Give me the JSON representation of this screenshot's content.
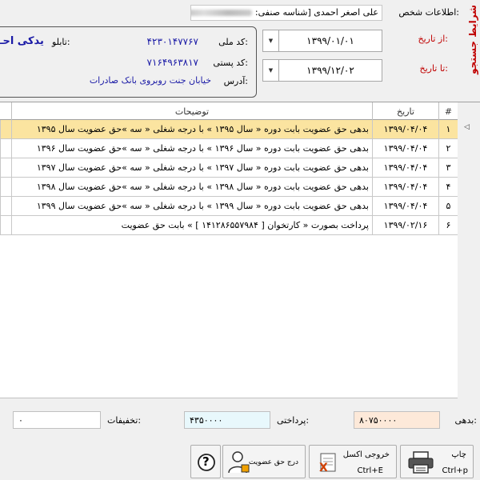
{
  "search_panel": {
    "title": "شرایط جستجو",
    "person_label": "اطلاعات شخص:",
    "person_value": "علی اصغر احمدی [شناسه صنفی:",
    "person_suffix": "]",
    "from_date_label": "از تاریخ:",
    "from_date": "۱۳۹۹/۰۱/۰۱",
    "to_date_label": "تا تاریخ:",
    "to_date": "۱۳۹۹/۱۲/۰۲"
  },
  "info": {
    "national_code_label": "کد ملی:",
    "national_code": "۴۲۳۰۱۴۷۷۶۷",
    "sign_label": "تابلو:",
    "sign_value": "یدکی احـ",
    "postal_code_label": "کد پستی:",
    "postal_code": "۷۱۶۴۹۶۳۸۱۷",
    "address_label": "آدرس:",
    "address": "خیابان جنت روبروی بانک صادرات"
  },
  "grid": {
    "columns": {
      "num": "#",
      "date": "تاریخ",
      "desc": "توضیحات"
    },
    "rows": [
      {
        "num": "۱",
        "date": "۱۳۹۹/۰۴/۰۴",
        "desc": "بدهی حق عضویت بابت دوره « سال ۱۳۹۵ » با درجه شغلی « سه »حق عضویت سال ۱۳۹۵",
        "selected": true
      },
      {
        "num": "۲",
        "date": "۱۳۹۹/۰۴/۰۴",
        "desc": "بدهی حق عضویت بابت دوره « سال ۱۳۹۶ » با درجه شغلی « سه »حق عضویت سال ۱۳۹۶",
        "selected": false
      },
      {
        "num": "۳",
        "date": "۱۳۹۹/۰۴/۰۴",
        "desc": "بدهی حق عضویت بابت دوره « سال ۱۳۹۷ » با درجه شغلی « سه »حق عضویت سال ۱۳۹۷",
        "selected": false
      },
      {
        "num": "۴",
        "date": "۱۳۹۹/۰۴/۰۴",
        "desc": "بدهی حق عضویت بابت دوره « سال ۱۳۹۸ » با درجه شغلی « سه »حق عضویت سال ۱۳۹۸",
        "selected": false
      },
      {
        "num": "۵",
        "date": "۱۳۹۹/۰۴/۰۴",
        "desc": "بدهی حق عضویت بابت دوره « سال ۱۳۹۹ » با درجه شغلی « سه »حق عضویت سال ۱۳۹۹",
        "selected": false
      },
      {
        "num": "۶",
        "date": "۱۳۹۹/۰۲/۱۶",
        "desc": "پرداخت بصورت « کارتخوان [ ۱۴۱۲۸۶۵۵۷۹۸۴ ] » بابت حق عضویت",
        "selected": false
      }
    ]
  },
  "totals": {
    "debt_label": "بدهی:",
    "debt": "۸۰۷۵۰۰۰۰",
    "paid_label": "پرداختی:",
    "paid": "۴۳۵۰۰۰۰",
    "discount_label": "تخفیفات:",
    "discount": "۰"
  },
  "buttons": {
    "print": "چاپ",
    "print_shortcut": "Ctrl+p",
    "excel": "خروجی اکسل",
    "excel_shortcut": "Ctrl+E",
    "membership": "درج حق عضویت",
    "help": "?"
  },
  "colors": {
    "selected_row": "#fbe4a0",
    "debt_bg": "#fde9d9",
    "paid_bg": "#e8f8fc",
    "accent_red": "#c00000",
    "info_blue": "#1a1aa6"
  }
}
